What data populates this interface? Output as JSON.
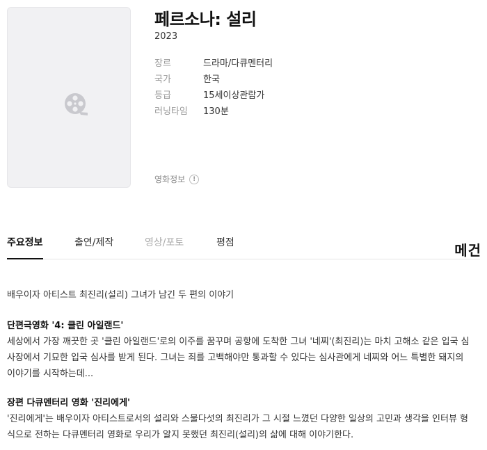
{
  "movie": {
    "title": "페르소나: 설리",
    "year": "2023",
    "info": [
      {
        "key": "장르",
        "value": "드라마/다큐멘터리"
      },
      {
        "key": "국가",
        "value": "한국"
      },
      {
        "key": "등급",
        "value": "15세이상관람가"
      },
      {
        "key": "러닝타임",
        "value": "130분"
      }
    ],
    "movie_info_label": "영화정보"
  },
  "tabs": [
    {
      "label": "주요정보"
    },
    {
      "label": "출연/제작"
    },
    {
      "label": "영상/포토"
    },
    {
      "label": "평점"
    }
  ],
  "brand": "메건",
  "synopsis": {
    "intro": "배우이자 아티스트 최진리(설리) 그녀가 남긴 두 편의 이야기",
    "section1_title": "단편극영화 '4: 클린 아일랜드'",
    "section1_lines": [
      "세상에서 가장 깨끗한 곳 '클린 아일랜드'로의 이주를 꿈꾸며 공항에 도착한 그녀 '네찌'(최진리)는 마치 고해소 같은 입국 심",
      "사장에서 기묘한 입국 심사를 받게 된다. 그녀는 죄를 고백해야만 통과할 수 있다는 심사관에게 네찌와 어느 특별한 돼지의",
      "이야기를 시작하는데..."
    ],
    "section2_title": "장편 다큐멘터리 영화 '진리에게'",
    "section2_lines": [
      "'진리에게'는 배우이자 아티스트로서의 설리와 스물다섯의 최진리가 그 시절 느꼈던 다양한 일상의 고민과 생각을 인터뷰 형",
      "식으로 전하는 다큐멘터리 영화로 우리가 알지 못했던 최진리(설리)의 삶에 대해 이야기한다."
    ]
  }
}
